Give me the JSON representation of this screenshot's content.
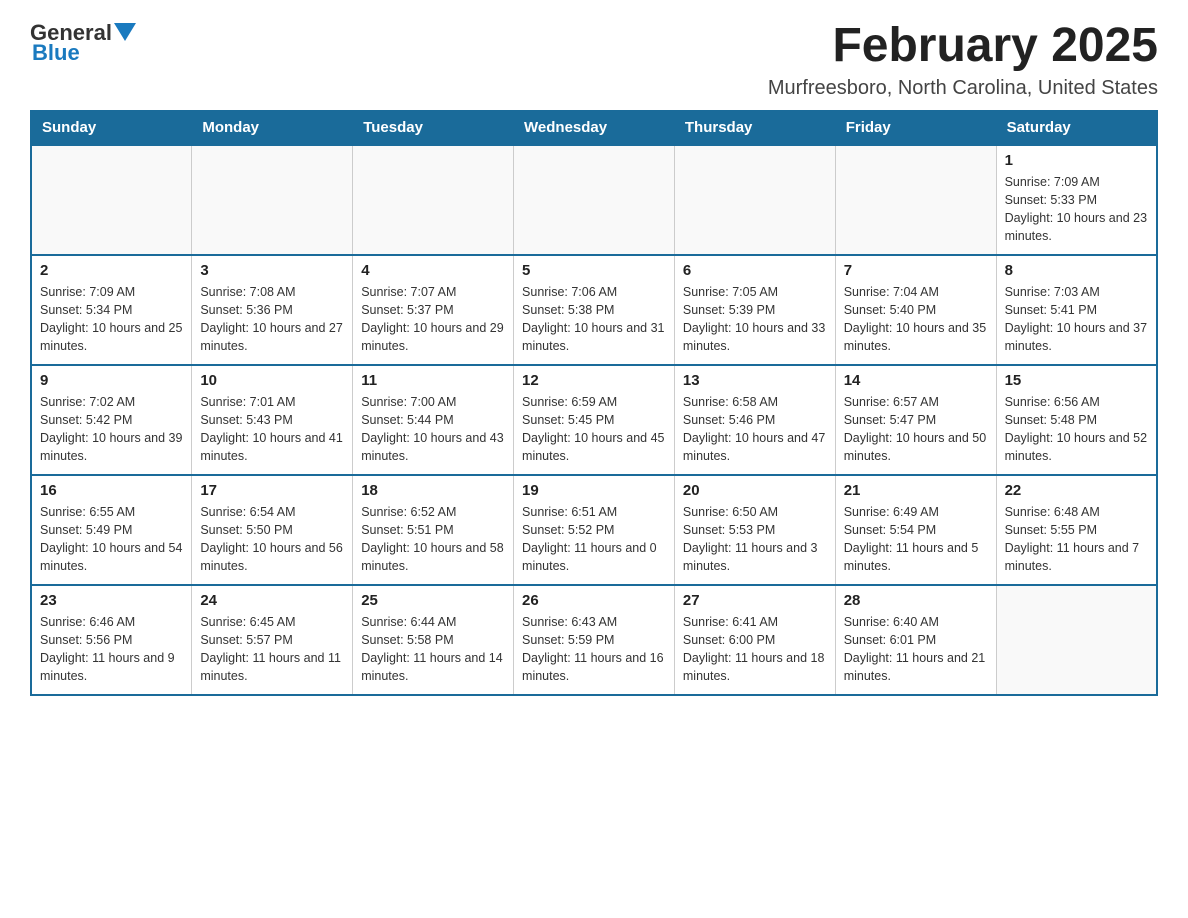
{
  "header": {
    "logo": {
      "text_general": "General",
      "text_blue": "Blue"
    },
    "title": "February 2025",
    "location": "Murfreesboro, North Carolina, United States"
  },
  "calendar": {
    "weekdays": [
      "Sunday",
      "Monday",
      "Tuesday",
      "Wednesday",
      "Thursday",
      "Friday",
      "Saturday"
    ],
    "weeks": [
      [
        {
          "day": "",
          "info": "",
          "empty": true
        },
        {
          "day": "",
          "info": "",
          "empty": true
        },
        {
          "day": "",
          "info": "",
          "empty": true
        },
        {
          "day": "",
          "info": "",
          "empty": true
        },
        {
          "day": "",
          "info": "",
          "empty": true
        },
        {
          "day": "",
          "info": "",
          "empty": true
        },
        {
          "day": "1",
          "info": "Sunrise: 7:09 AM\nSunset: 5:33 PM\nDaylight: 10 hours and 23 minutes.",
          "empty": false
        }
      ],
      [
        {
          "day": "2",
          "info": "Sunrise: 7:09 AM\nSunset: 5:34 PM\nDaylight: 10 hours and 25 minutes.",
          "empty": false
        },
        {
          "day": "3",
          "info": "Sunrise: 7:08 AM\nSunset: 5:36 PM\nDaylight: 10 hours and 27 minutes.",
          "empty": false
        },
        {
          "day": "4",
          "info": "Sunrise: 7:07 AM\nSunset: 5:37 PM\nDaylight: 10 hours and 29 minutes.",
          "empty": false
        },
        {
          "day": "5",
          "info": "Sunrise: 7:06 AM\nSunset: 5:38 PM\nDaylight: 10 hours and 31 minutes.",
          "empty": false
        },
        {
          "day": "6",
          "info": "Sunrise: 7:05 AM\nSunset: 5:39 PM\nDaylight: 10 hours and 33 minutes.",
          "empty": false
        },
        {
          "day": "7",
          "info": "Sunrise: 7:04 AM\nSunset: 5:40 PM\nDaylight: 10 hours and 35 minutes.",
          "empty": false
        },
        {
          "day": "8",
          "info": "Sunrise: 7:03 AM\nSunset: 5:41 PM\nDaylight: 10 hours and 37 minutes.",
          "empty": false
        }
      ],
      [
        {
          "day": "9",
          "info": "Sunrise: 7:02 AM\nSunset: 5:42 PM\nDaylight: 10 hours and 39 minutes.",
          "empty": false
        },
        {
          "day": "10",
          "info": "Sunrise: 7:01 AM\nSunset: 5:43 PM\nDaylight: 10 hours and 41 minutes.",
          "empty": false
        },
        {
          "day": "11",
          "info": "Sunrise: 7:00 AM\nSunset: 5:44 PM\nDaylight: 10 hours and 43 minutes.",
          "empty": false
        },
        {
          "day": "12",
          "info": "Sunrise: 6:59 AM\nSunset: 5:45 PM\nDaylight: 10 hours and 45 minutes.",
          "empty": false
        },
        {
          "day": "13",
          "info": "Sunrise: 6:58 AM\nSunset: 5:46 PM\nDaylight: 10 hours and 47 minutes.",
          "empty": false
        },
        {
          "day": "14",
          "info": "Sunrise: 6:57 AM\nSunset: 5:47 PM\nDaylight: 10 hours and 50 minutes.",
          "empty": false
        },
        {
          "day": "15",
          "info": "Sunrise: 6:56 AM\nSunset: 5:48 PM\nDaylight: 10 hours and 52 minutes.",
          "empty": false
        }
      ],
      [
        {
          "day": "16",
          "info": "Sunrise: 6:55 AM\nSunset: 5:49 PM\nDaylight: 10 hours and 54 minutes.",
          "empty": false
        },
        {
          "day": "17",
          "info": "Sunrise: 6:54 AM\nSunset: 5:50 PM\nDaylight: 10 hours and 56 minutes.",
          "empty": false
        },
        {
          "day": "18",
          "info": "Sunrise: 6:52 AM\nSunset: 5:51 PM\nDaylight: 10 hours and 58 minutes.",
          "empty": false
        },
        {
          "day": "19",
          "info": "Sunrise: 6:51 AM\nSunset: 5:52 PM\nDaylight: 11 hours and 0 minutes.",
          "empty": false
        },
        {
          "day": "20",
          "info": "Sunrise: 6:50 AM\nSunset: 5:53 PM\nDaylight: 11 hours and 3 minutes.",
          "empty": false
        },
        {
          "day": "21",
          "info": "Sunrise: 6:49 AM\nSunset: 5:54 PM\nDaylight: 11 hours and 5 minutes.",
          "empty": false
        },
        {
          "day": "22",
          "info": "Sunrise: 6:48 AM\nSunset: 5:55 PM\nDaylight: 11 hours and 7 minutes.",
          "empty": false
        }
      ],
      [
        {
          "day": "23",
          "info": "Sunrise: 6:46 AM\nSunset: 5:56 PM\nDaylight: 11 hours and 9 minutes.",
          "empty": false
        },
        {
          "day": "24",
          "info": "Sunrise: 6:45 AM\nSunset: 5:57 PM\nDaylight: 11 hours and 11 minutes.",
          "empty": false
        },
        {
          "day": "25",
          "info": "Sunrise: 6:44 AM\nSunset: 5:58 PM\nDaylight: 11 hours and 14 minutes.",
          "empty": false
        },
        {
          "day": "26",
          "info": "Sunrise: 6:43 AM\nSunset: 5:59 PM\nDaylight: 11 hours and 16 minutes.",
          "empty": false
        },
        {
          "day": "27",
          "info": "Sunrise: 6:41 AM\nSunset: 6:00 PM\nDaylight: 11 hours and 18 minutes.",
          "empty": false
        },
        {
          "day": "28",
          "info": "Sunrise: 6:40 AM\nSunset: 6:01 PM\nDaylight: 11 hours and 21 minutes.",
          "empty": false
        },
        {
          "day": "",
          "info": "",
          "empty": true
        }
      ]
    ]
  }
}
